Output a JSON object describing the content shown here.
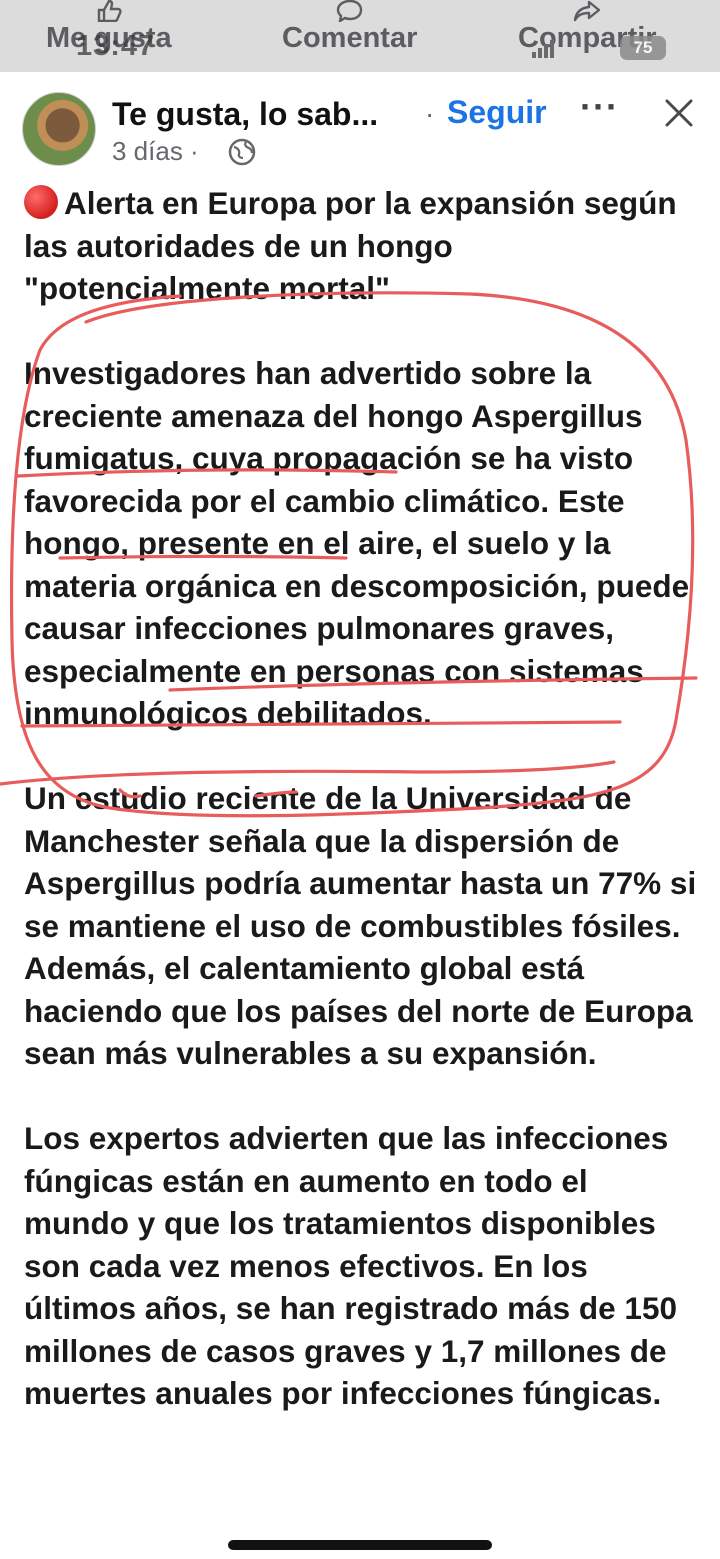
{
  "statusbar": {
    "time": "13:47",
    "battery": "75"
  },
  "actions": {
    "like_label": "Me gusta",
    "comment_label": "Comentar",
    "share_label": "Compartir"
  },
  "header": {
    "page_name": "Te gusta, lo sab...",
    "separator": "·",
    "follow_label": "Seguir",
    "more_label": "···",
    "time_ago": "3 días ·"
  },
  "post": {
    "alert_text": "Alerta en Europa por la expansión según las autoridades de un hongo \"potencialmente mortal\"",
    "paragraph_1": "Investigadores han advertido sobre la creciente amenaza del hongo Aspergillus fumigatus, cuya propagación se ha visto favorecida por el cambio climático. Este hongo, presente en el aire, el suelo y la materia orgánica en descomposición, puede causar infecciones pulmonares graves, especialmente en personas con sistemas inmunológicos debilitados.",
    "paragraph_2": "Un estudio reciente de la Universidad de Manchester señala que la dispersión de Aspergillus podría aumentar hasta un 77% si se mantiene el uso de combustibles fósiles. Además, el calentamiento global está haciendo que los países del norte de Europa sean más vulnerables a su expansión.",
    "paragraph_3": "Los expertos advierten que las infecciones fúngicas están en aumento en todo el mundo y que los tratamientos disponibles son cada vez menos efectivos. En los últimos años, se han registrado más de 150 millones de casos graves y 1,7 millones de muertes anuales por infecciones fúngicas."
  },
  "colors": {
    "follow_blue": "#1b74e4",
    "annotation_red": "#e85c5c",
    "alert_red": "#d21f1f"
  },
  "icons": [
    "like-icon",
    "comment-icon",
    "share-icon",
    "globe-icon",
    "close-icon",
    "alert-dot-icon"
  ]
}
